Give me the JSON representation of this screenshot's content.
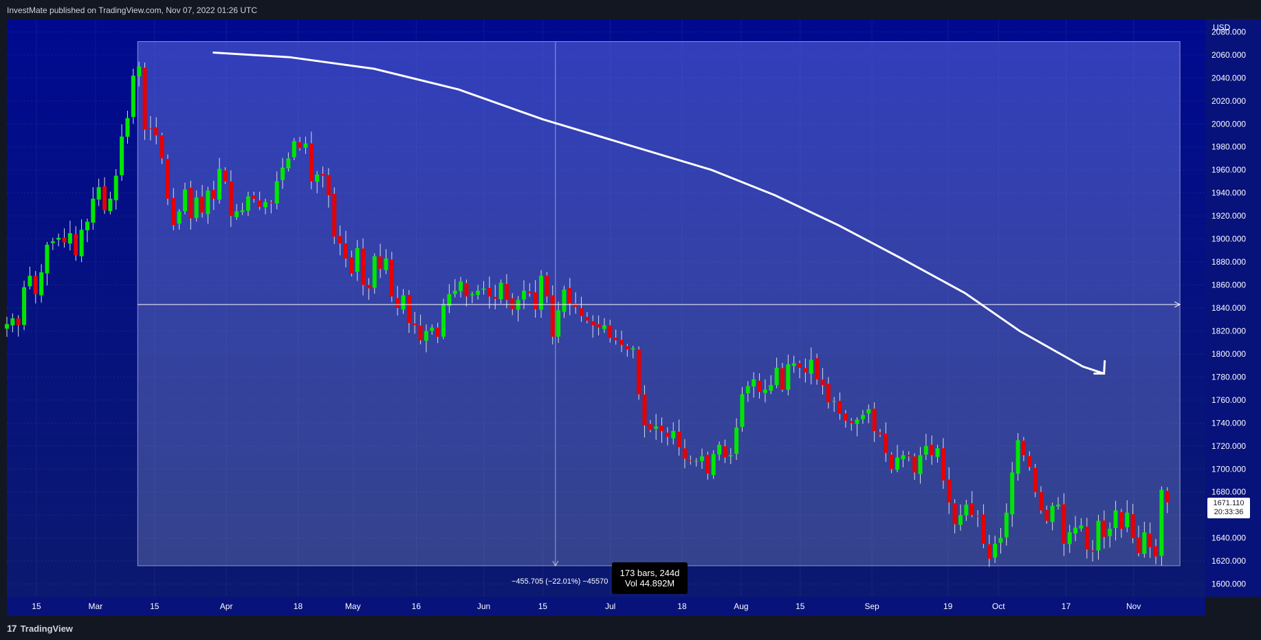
{
  "header": {
    "text": "InvestMate published on TradingView.com, Nov 07, 2022 01:26 UTC"
  },
  "footer": {
    "logo_text": "TradingView",
    "logo_icon": "tradingview-logo-icon"
  },
  "colors": {
    "background_top": "#000a8f",
    "background_bottom": "#0c1a7a",
    "up": "#00e600",
    "down": "#e60000",
    "wick": "#d8dce8",
    "measure_fill": "#6a78d0",
    "curve": "#ffffff"
  },
  "tooltip": {
    "bars_label": "173 bars, 244d",
    "vol_label": "Vol 44.892M"
  },
  "measure": {
    "change_label": "−455.705 (−22.01%) −45570"
  },
  "price_tag": {
    "price": "1671.110",
    "countdown": "20:33:36"
  },
  "chart_data": {
    "type": "candlestick",
    "currency_label": "USD",
    "y_ticks": [
      1600,
      1620,
      1640,
      1660,
      1680,
      1700,
      1720,
      1740,
      1760,
      1780,
      1800,
      1820,
      1840,
      1860,
      1880,
      1900,
      1920,
      1940,
      1960,
      1980,
      2000,
      2020,
      2040,
      2060,
      2080
    ],
    "y_tick_labels": [
      "1600.000",
      "1620.000",
      "1640.000",
      "1660.000",
      "1680.000",
      "1700.000",
      "1720.000",
      "1740.000",
      "1760.000",
      "1780.000",
      "1800.000",
      "1820.000",
      "1840.000",
      "1860.000",
      "1880.000",
      "1900.000",
      "1920.000",
      "1940.000",
      "1960.000",
      "1980.000",
      "2000.000",
      "2020.000",
      "2040.000",
      "2060.000",
      "2080.000"
    ],
    "ylim": [
      1589,
      2091
    ],
    "x_labels": [
      {
        "label": "15",
        "day": 0
      },
      {
        "label": "Mar",
        "day": 14
      },
      {
        "label": "15",
        "day": 28
      },
      {
        "label": "Apr",
        "day": 45
      },
      {
        "label": "18",
        "day": 62
      },
      {
        "label": "May",
        "day": 75
      },
      {
        "label": "16",
        "day": 90
      },
      {
        "label": "Jun",
        "day": 106
      },
      {
        "label": "15",
        "day": 120
      },
      {
        "label": "Jul",
        "day": 136
      },
      {
        "label": "18",
        "day": 153
      },
      {
        "label": "Aug",
        "day": 167
      },
      {
        "label": "15",
        "day": 181
      },
      {
        "label": "Sep",
        "day": 198
      },
      {
        "label": "19",
        "day": 216
      },
      {
        "label": "Oct",
        "day": 228
      },
      {
        "label": "17",
        "day": 244
      },
      {
        "label": "Nov",
        "day": 260
      }
    ],
    "xlim": [
      -7,
      277
    ],
    "candles_close": [
      1826,
      1831,
      1825,
      1858,
      1868,
      1852,
      1871,
      1895,
      1898,
      1901,
      1897,
      1905,
      1886,
      1908,
      1915,
      1935,
      1945,
      1925,
      1935,
      1955,
      1989,
      2005,
      2042,
      2050,
      1995,
      1996,
      1990,
      1970,
      1935,
      1912,
      1924,
      1943,
      1918,
      1936,
      1923,
      1942,
      1935,
      1961,
      1950,
      1920,
      1924,
      1925,
      1937,
      1935,
      1928,
      1932,
      1931,
      1950,
      1962,
      1970,
      1985,
      1979,
      1983,
      1950,
      1956,
      1955,
      1938,
      1902,
      1896,
      1883,
      1870,
      1892,
      1860,
      1857,
      1885,
      1874,
      1883,
      1850,
      1840,
      1851,
      1827,
      1825,
      1812,
      1820,
      1823,
      1815,
      1843,
      1852,
      1855,
      1863,
      1850,
      1852,
      1855,
      1857,
      1850,
      1848,
      1862,
      1847,
      1839,
      1847,
      1855,
      1853,
      1839,
      1868,
      1850,
      1815,
      1838,
      1856,
      1844,
      1841,
      1833,
      1829,
      1825,
      1823,
      1825,
      1814,
      1812,
      1808,
      1804,
      1805,
      1765,
      1738,
      1734,
      1737,
      1733,
      1728,
      1733,
      1719,
      1709,
      1707,
      1707,
      1711,
      1696,
      1713,
      1721,
      1710,
      1712,
      1736,
      1765,
      1772,
      1778,
      1767,
      1769,
      1773,
      1788,
      1769,
      1791,
      1792,
      1788,
      1784,
      1795,
      1778,
      1773,
      1758,
      1759,
      1748,
      1742,
      1740,
      1743,
      1747,
      1752,
      1733,
      1730,
      1714,
      1700,
      1710,
      1712,
      1711,
      1697,
      1712,
      1720,
      1712,
      1718,
      1690,
      1671,
      1652,
      1660,
      1669,
      1660,
      1659,
      1635,
      1622,
      1635,
      1640,
      1662,
      1697,
      1725,
      1712,
      1702,
      1680,
      1664,
      1655,
      1668,
      1669,
      1635,
      1645,
      1649,
      1651,
      1630,
      1628,
      1655,
      1641,
      1648,
      1664,
      1648,
      1662,
      1640,
      1627,
      1645,
      1632,
      1624,
      1682,
      1671
    ],
    "series_note": "daily OHLC; opens/highs/lows derived per bar"
  }
}
